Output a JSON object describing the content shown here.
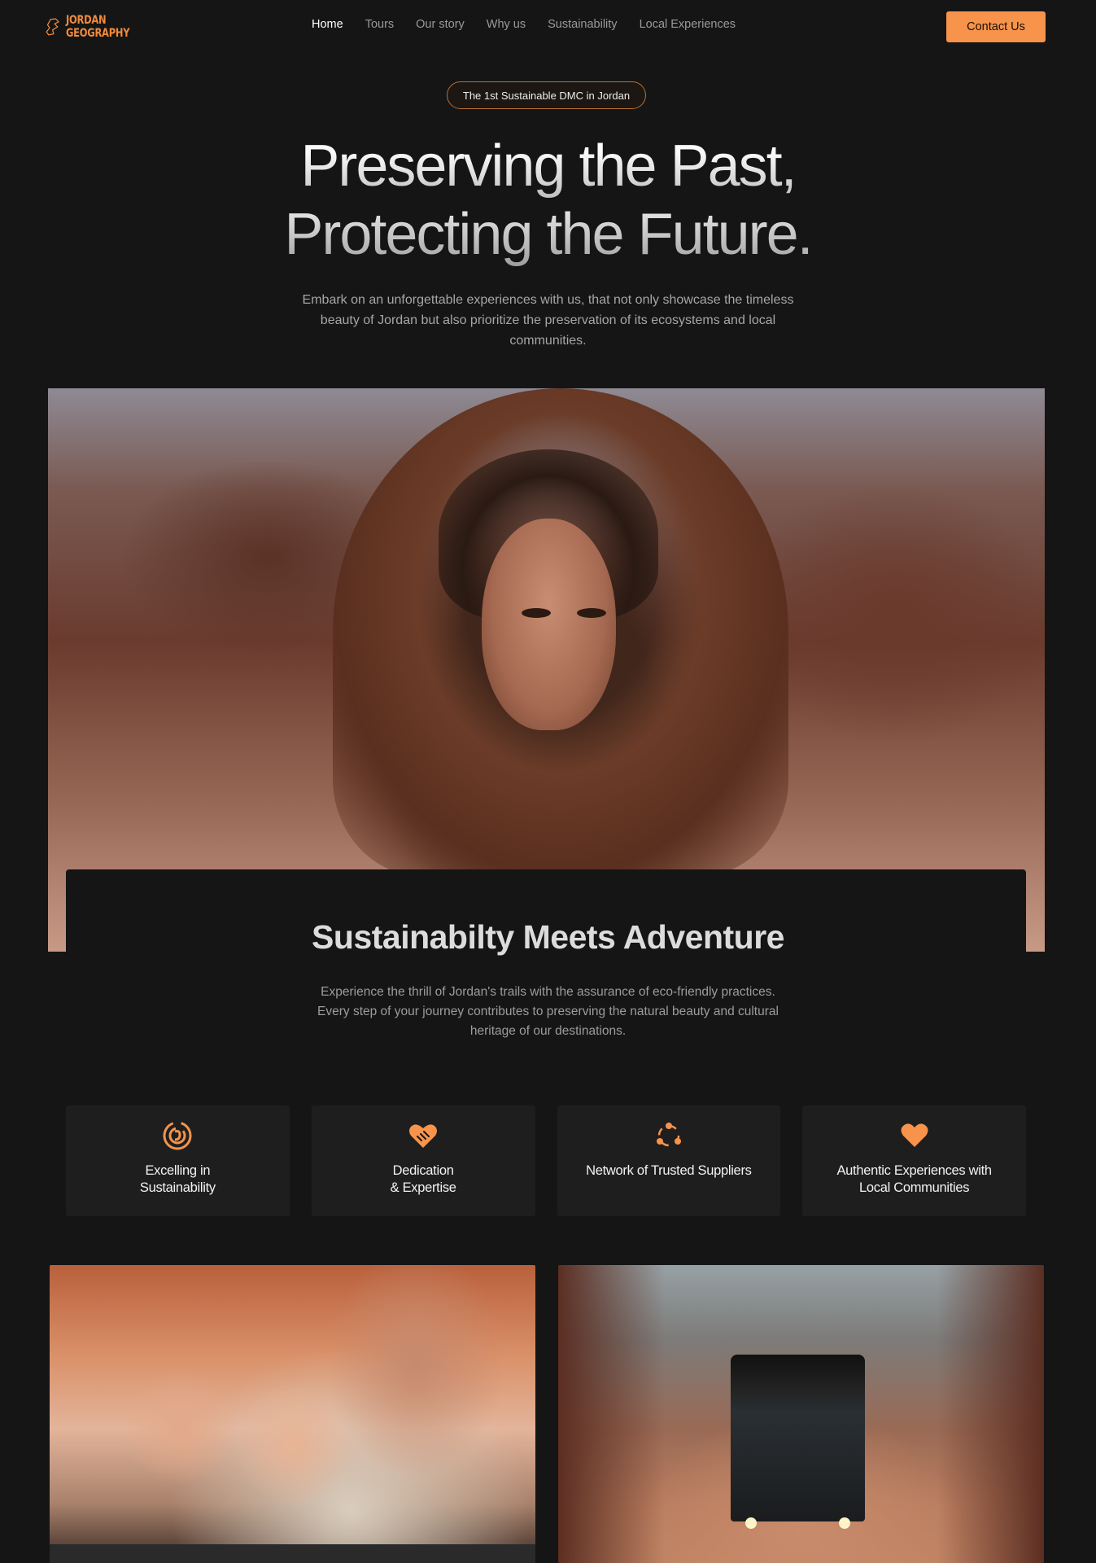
{
  "nav": {
    "logo_line1": "JORDAN",
    "logo_line2": "GEOGRAPHY",
    "links": [
      {
        "label": "Home",
        "active": true
      },
      {
        "label": "Tours",
        "active": false
      },
      {
        "label": "Our story",
        "active": false
      },
      {
        "label": "Why us",
        "active": false
      },
      {
        "label": "Sustainability",
        "active": false
      },
      {
        "label": "Local Experiences",
        "active": false
      }
    ],
    "cta_label": "Contact Us"
  },
  "hero": {
    "badge": "The 1st Sustainable DMC in Jordan",
    "title_line1": "Preserving the Past,",
    "title_line2": "Protecting the Future.",
    "subtitle": "Embark on an unforgettable experiences with us, that not only showcase the timeless beauty of Jordan but also prioritize the preservation of its ecosystems and local communities."
  },
  "section": {
    "title": "Sustainabilty Meets Adventure",
    "subtitle": "Experience the thrill of Jordan's trails with the assurance of eco-friendly practices. Every step of your journey contributes to preserving the natural beauty and cultural heritage of our destinations."
  },
  "features": [
    {
      "icon": "sustainability-icon",
      "label": "Excelling in\nSustainability"
    },
    {
      "icon": "handshake-heart-icon",
      "label": "Dedication\n& Expertise"
    },
    {
      "icon": "network-icon",
      "label": "Network of Trusted Suppliers"
    },
    {
      "icon": "heart-icon",
      "label": "Authentic Experiences with\nLocal Communities"
    }
  ],
  "colors": {
    "accent": "#f7934a",
    "background": "#151515",
    "card": "#1e1e1e"
  }
}
